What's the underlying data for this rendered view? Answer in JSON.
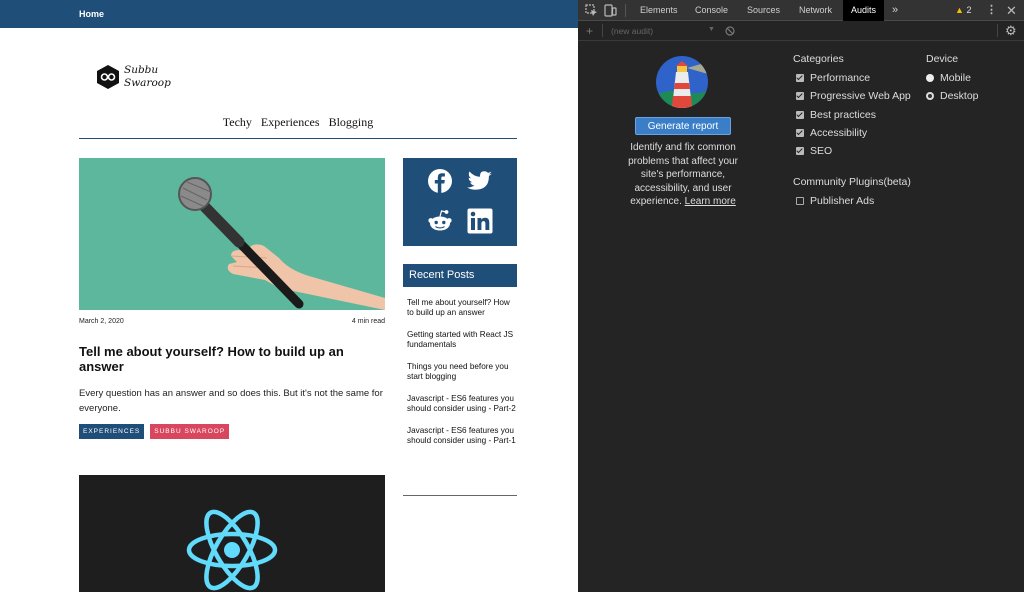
{
  "site": {
    "topbar": {
      "home": "Home"
    },
    "logo": {
      "line1": "Subbu",
      "line2": "Swaroop"
    },
    "nav": [
      "Techy",
      "Experiences",
      "Blogging"
    ],
    "featured": {
      "date": "March 2, 2020",
      "read_time": "4 min read",
      "title": "Tell me about yourself? How to build up an answer",
      "excerpt": "Every question has an answer and so does this. But it's not the same for everyone.",
      "tags": [
        "EXPERIENCES",
        "SUBBU SWAROOP"
      ]
    },
    "sidebar": {
      "social_icons": [
        "facebook-icon",
        "twitter-icon",
        "reddit-icon",
        "linkedin-icon"
      ],
      "recent_header": "Recent Posts",
      "recent_posts": [
        "Tell me about yourself? How to build up an answer",
        "Getting started with React JS fundamentals",
        "Things you need before you start blogging",
        "Javascript - ES6 features you should consider using - Part-2",
        "Javascript - ES6 features you should consider using - Part-1"
      ]
    },
    "colors": {
      "brand": "#1f4e79",
      "tag_red": "#d9475f",
      "hero_bg": "#5db79d"
    }
  },
  "devtools": {
    "tabs": [
      "Elements",
      "Console",
      "Sources",
      "Network",
      "Audits"
    ],
    "active_tab": "Audits",
    "more_tabs": "»",
    "warning_count": "2",
    "audit_select_placeholder": "(new audit)",
    "generate_button": "Generate report",
    "description": "Identify and fix common problems that affect your site's performance, accessibility, and user experience.",
    "learn_more": "Learn more",
    "categories": {
      "heading": "Categories",
      "items": [
        {
          "label": "Performance",
          "checked": true
        },
        {
          "label": "Progressive Web App",
          "checked": true
        },
        {
          "label": "Best practices",
          "checked": true
        },
        {
          "label": "Accessibility",
          "checked": true
        },
        {
          "label": "SEO",
          "checked": true
        }
      ]
    },
    "device": {
      "heading": "Device",
      "options": [
        {
          "label": "Mobile",
          "selected": false
        },
        {
          "label": "Desktop",
          "selected": true
        }
      ]
    },
    "plugins": {
      "heading": "Community Plugins(beta)",
      "items": [
        {
          "label": "Publisher Ads",
          "checked": false
        }
      ]
    },
    "colors": {
      "panel_bg": "#242424",
      "button_blue": "#3a7ec8",
      "warning": "#f4bd00"
    }
  }
}
